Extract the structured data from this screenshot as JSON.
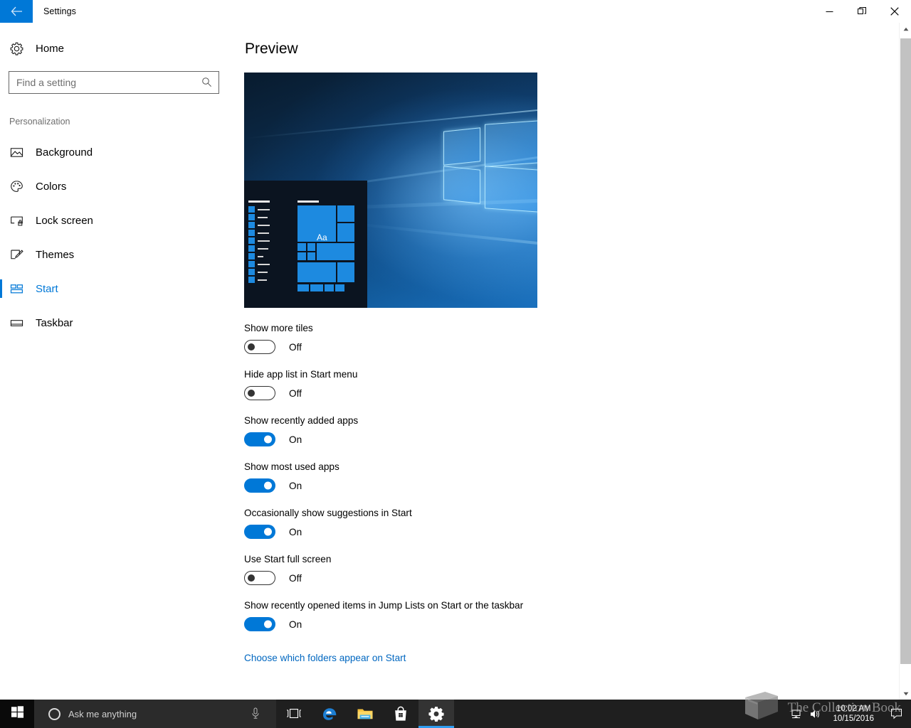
{
  "titlebar": {
    "back_icon": "back-arrow-icon",
    "title": "Settings",
    "accent_color": "#0078d7",
    "minimize_label": "Minimize",
    "restore_label": "Restore",
    "close_label": "Close"
  },
  "sidebar": {
    "home": {
      "icon": "gear-icon",
      "label": "Home"
    },
    "search": {
      "placeholder": "Find a setting",
      "value": "",
      "icon": "search-icon"
    },
    "category": "Personalization",
    "items": [
      {
        "icon": "picture-icon",
        "label": "Background",
        "selected": false
      },
      {
        "icon": "palette-icon",
        "label": "Colors",
        "selected": false
      },
      {
        "icon": "lock-screen-icon",
        "label": "Lock screen",
        "selected": false
      },
      {
        "icon": "brush-icon",
        "label": "Themes",
        "selected": false
      },
      {
        "icon": "start-tiles-icon",
        "label": "Start",
        "selected": true
      },
      {
        "icon": "taskbar-icon",
        "label": "Taskbar",
        "selected": false
      }
    ]
  },
  "main": {
    "heading": "Preview",
    "preview": {
      "alt": "start-menu-preview",
      "tile_text": "Aa"
    },
    "settings": [
      {
        "label": "Show more tiles",
        "state": "Off",
        "on": false
      },
      {
        "label": "Hide app list in Start menu",
        "state": "Off",
        "on": false
      },
      {
        "label": "Show recently added apps",
        "state": "On",
        "on": true
      },
      {
        "label": "Show most used apps",
        "state": "On",
        "on": true
      },
      {
        "label": "Occasionally show suggestions in Start",
        "state": "On",
        "on": true
      },
      {
        "label": "Use Start full screen",
        "state": "Off",
        "on": false
      },
      {
        "label": "Show recently opened items in Jump Lists on Start or the taskbar",
        "state": "On",
        "on": true
      }
    ],
    "link": "Choose which folders appear on Start",
    "link_color": "#0067c0"
  },
  "scrollbar": {
    "up_arrow": "▲",
    "down_arrow": "▼"
  },
  "taskbar": {
    "start_icon": "windows-logo-icon",
    "cortana": {
      "placeholder": "Ask me anything",
      "circle_icon": "cortana-circle-icon",
      "mic_icon": "microphone-icon"
    },
    "icons": [
      {
        "name": "task-view-icon",
        "active": false
      },
      {
        "name": "edge-browser-icon",
        "active": false
      },
      {
        "name": "file-explorer-icon",
        "active": false
      },
      {
        "name": "microsoft-store-icon",
        "active": false
      },
      {
        "name": "settings-gear-icon",
        "active": true
      }
    ],
    "tray": [
      "network-icon",
      "volume-icon"
    ],
    "clock": {
      "time": "10:02 AM",
      "date": "10/15/2016"
    },
    "action_center_icon": "action-center-icon",
    "accent_color": "#2e9cf0"
  },
  "watermark": {
    "text": "The Collection Book",
    "logo": "book-logo-icon"
  }
}
